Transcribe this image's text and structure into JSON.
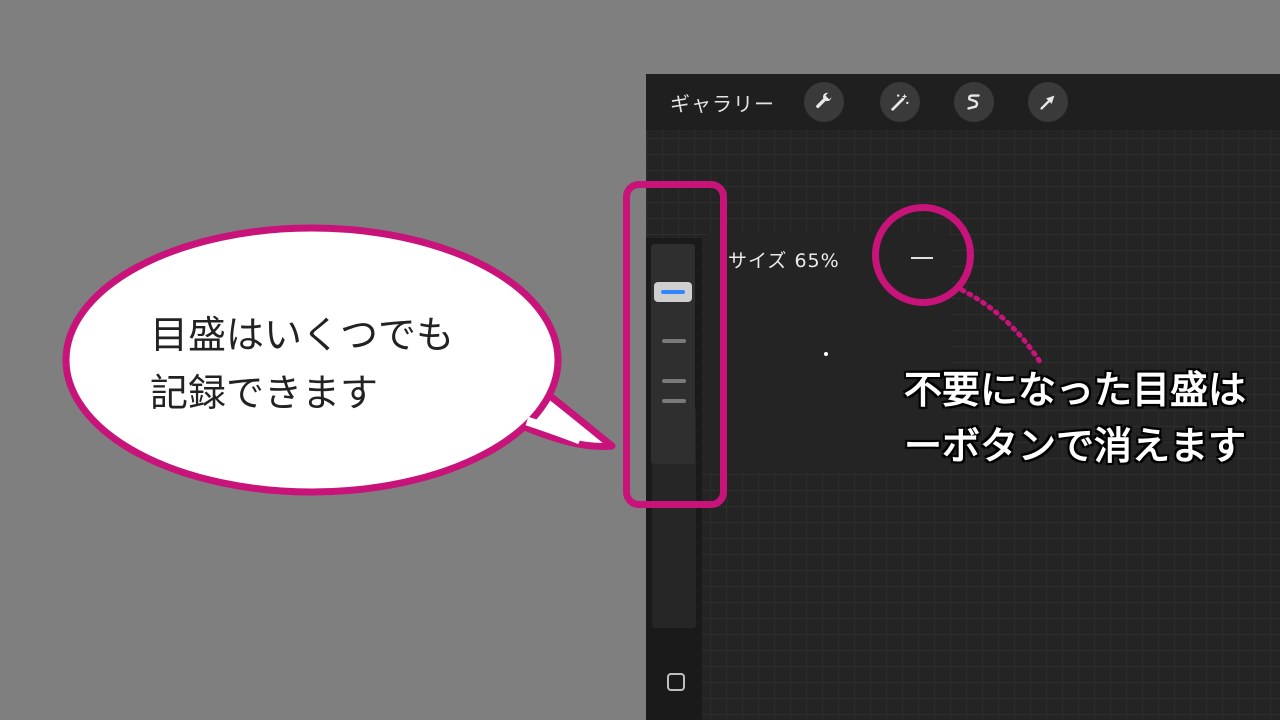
{
  "toolbar": {
    "gallery_label": "ギャラリー",
    "icons": [
      "wrench-icon",
      "magic-wand-icon",
      "selection-s-icon",
      "arrow-icon"
    ]
  },
  "popup": {
    "size_label": "サイズ 65%",
    "size_percent": 65,
    "minus_label": "—"
  },
  "annotations": {
    "bubble_line1": "目盛はいくつでも",
    "bubble_line2": "記録できます",
    "note_line1": "不要になった目盛は",
    "note_line2": "ーボタンで消えます"
  },
  "colors": {
    "accent": "#c8137a",
    "active_mark": "#2f86ff",
    "background": "#7f7f7f",
    "canvas": "#242424"
  }
}
